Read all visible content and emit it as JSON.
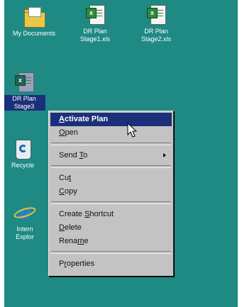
{
  "desktop": {
    "background_color": "#1f8a84",
    "icons": [
      {
        "id": "my-documents",
        "label": "My Documents",
        "icon": "folder-icon"
      },
      {
        "id": "dr-plan-stage1",
        "label": "DR Plan\nStage1.xls",
        "icon": "excel-file-icon"
      },
      {
        "id": "dr-plan-stage2",
        "label": "DR Plan\nStage2.xls",
        "icon": "excel-file-icon"
      },
      {
        "id": "dr-plan-stage3",
        "label": "DR Plan\nStage3",
        "icon": "excel-file-icon",
        "selected": true
      },
      {
        "id": "recycle-bin",
        "label": "Recycle",
        "icon": "recycle-bin-icon"
      },
      {
        "id": "internet-explorer",
        "label": "Intern\nExplor",
        "icon": "internet-explorer-icon"
      }
    ]
  },
  "context_menu": {
    "accent_color": "#1c2f7a",
    "items": [
      {
        "pre": "",
        "key": "A",
        "post": "ctivate Plan",
        "default": true,
        "highlighted": true
      },
      {
        "pre": "",
        "key": "O",
        "post": "pen"
      },
      {
        "pre": "Send ",
        "key": "T",
        "post": "o",
        "submenu": true
      },
      {
        "pre": "Cu",
        "key": "t",
        "post": ""
      },
      {
        "pre": "",
        "key": "C",
        "post": "opy"
      },
      {
        "pre": "Create ",
        "key": "S",
        "post": "hortcut"
      },
      {
        "pre": "",
        "key": "D",
        "post": "elete"
      },
      {
        "pre": "Rena",
        "key": "m",
        "post": "e"
      },
      {
        "pre": "P",
        "key": "r",
        "post": "operties"
      }
    ]
  },
  "cursor": {
    "icon": "arrow-pointer-icon"
  }
}
